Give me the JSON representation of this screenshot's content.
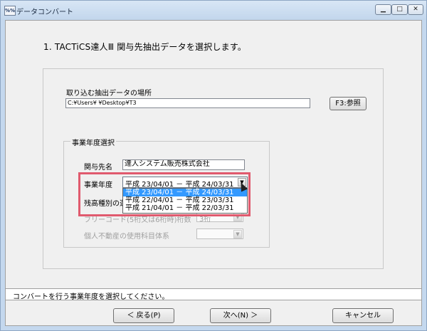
{
  "window": {
    "title": "データコンバート",
    "icon_text": "%%"
  },
  "heading": "1. TACTiCS達人Ⅲ 関与先抽出データを選択します。",
  "location": {
    "label": "取り込む抽出データの場所",
    "path": "C:¥Users¥        ¥Desktop¥T3",
    "browse_button": "F3:参照"
  },
  "fiscal_group": {
    "title": "事業年度選択",
    "client_label": "関与先名",
    "client_name": "達人システム販売株式会社",
    "year_label": "事業年度",
    "year_selected": "平成 23/04/01 － 平成 24/03/31",
    "year_options": [
      "平成 23/04/01 － 平成 24/03/31",
      "平成 22/04/01 － 平成 23/03/31",
      "平成 21/04/01 － 平成 22/03/31"
    ],
    "balance_label": "残高種別の選",
    "freecode_label": "フリーコード(5桁又は6桁時)桁数",
    "freecode_value": "3桁",
    "realestate_label": "個人不動産の使用科目体系"
  },
  "status": "コンバートを行う事業年度を選択してください。",
  "footer": {
    "back": "＜ 戻る(P)",
    "next": "次へ(N) ＞",
    "cancel": "キャンセル"
  },
  "icons": {
    "minimize": "minimize-icon",
    "maximize": "maximize-icon",
    "close": "close-icon",
    "dropdown": "chevron-down-icon",
    "cursor": "mouse-cursor-icon"
  }
}
